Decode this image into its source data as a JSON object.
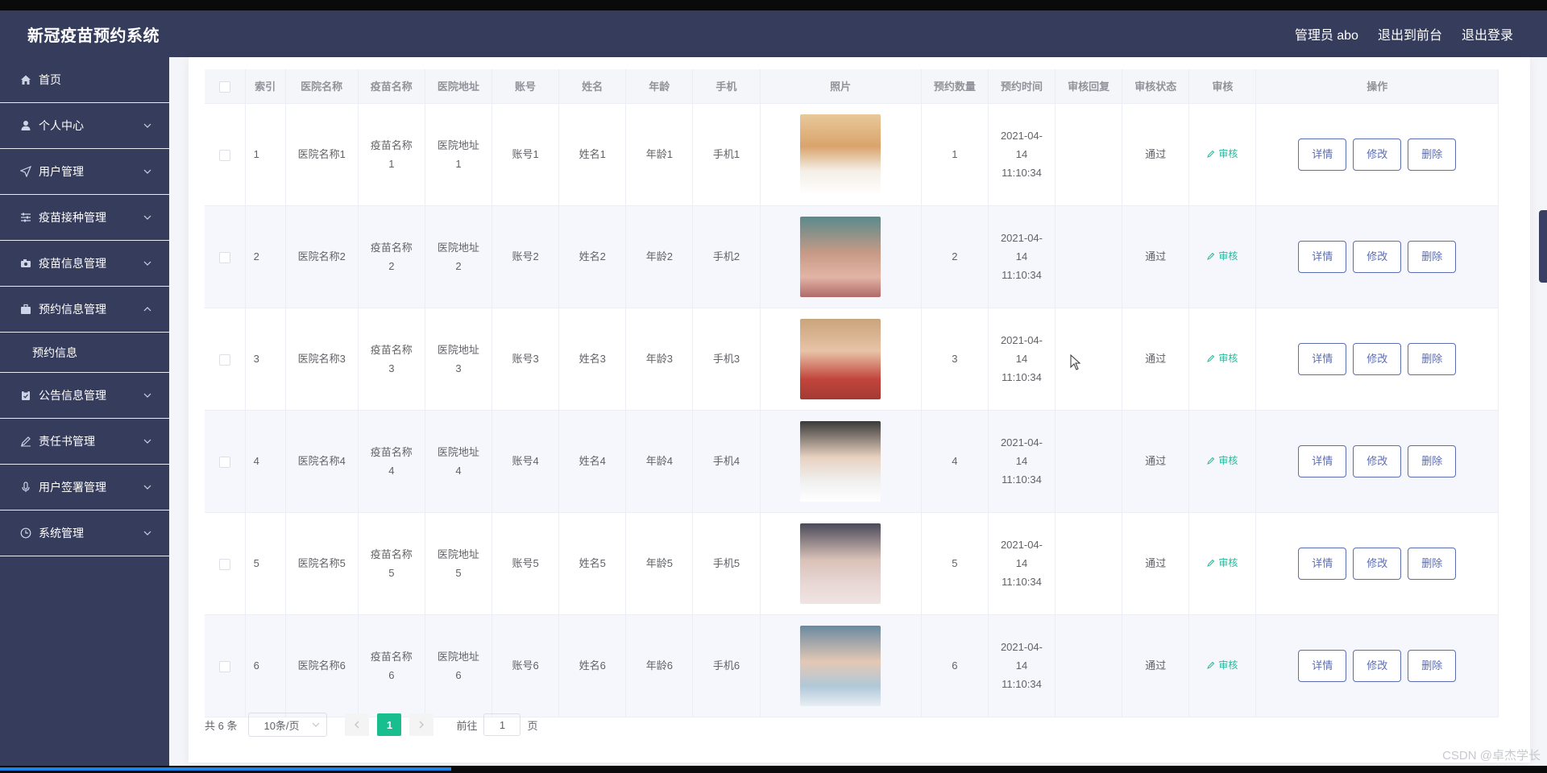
{
  "app": {
    "title": "新冠疫苗预约系统"
  },
  "header": {
    "user": "管理员 abo",
    "front": "退出到前台",
    "logout": "退出登录"
  },
  "sidebar": {
    "items": [
      {
        "label": "首页",
        "icon": "home-icon",
        "expandable": false
      },
      {
        "label": "个人中心",
        "icon": "user-icon",
        "expandable": true
      },
      {
        "label": "用户管理",
        "icon": "send-icon",
        "expandable": true
      },
      {
        "label": "疫苗接种管理",
        "icon": "sliders-icon",
        "expandable": true
      },
      {
        "label": "疫苗信息管理",
        "icon": "camera-icon",
        "expandable": true
      },
      {
        "label": "预约信息管理",
        "icon": "briefcase-icon",
        "expandable": true,
        "expanded": true
      },
      {
        "label": "公告信息管理",
        "icon": "clipboard-icon",
        "expandable": true
      },
      {
        "label": "责任书管理",
        "icon": "pen-icon",
        "expandable": true
      },
      {
        "label": "用户签署管理",
        "icon": "microphone-icon",
        "expandable": true
      },
      {
        "label": "系统管理",
        "icon": "clock-icon",
        "expandable": true
      }
    ],
    "submenu": {
      "label": "预约信息"
    }
  },
  "table": {
    "columns": [
      "",
      "索引",
      "医院名称",
      "疫苗名称",
      "医院地址",
      "账号",
      "姓名",
      "年龄",
      "手机",
      "照片",
      "预约数量",
      "预约时间",
      "审核回复",
      "审核状态",
      "审核",
      "操作"
    ],
    "rows": [
      {
        "index": "1",
        "hospital": "医院名称1",
        "vaccine": "疫苗名称1",
        "address": "医院地址1",
        "account": "账号1",
        "name": "姓名1",
        "age": "年龄1",
        "phone": "手机1",
        "count": "1",
        "time": "2021-04-14 11:10:34",
        "reply": "",
        "status": "通过",
        "photo": "photo-1"
      },
      {
        "index": "2",
        "hospital": "医院名称2",
        "vaccine": "疫苗名称2",
        "address": "医院地址2",
        "account": "账号2",
        "name": "姓名2",
        "age": "年龄2",
        "phone": "手机2",
        "count": "2",
        "time": "2021-04-14 11:10:34",
        "reply": "",
        "status": "通过",
        "photo": "photo-2"
      },
      {
        "index": "3",
        "hospital": "医院名称3",
        "vaccine": "疫苗名称3",
        "address": "医院地址3",
        "account": "账号3",
        "name": "姓名3",
        "age": "年龄3",
        "phone": "手机3",
        "count": "3",
        "time": "2021-04-14 11:10:34",
        "reply": "",
        "status": "通过",
        "photo": "photo-3"
      },
      {
        "index": "4",
        "hospital": "医院名称4",
        "vaccine": "疫苗名称4",
        "address": "医院地址4",
        "account": "账号4",
        "name": "姓名4",
        "age": "年龄4",
        "phone": "手机4",
        "count": "4",
        "time": "2021-04-14 11:10:34",
        "reply": "",
        "status": "通过",
        "photo": "photo-4"
      },
      {
        "index": "5",
        "hospital": "医院名称5",
        "vaccine": "疫苗名称5",
        "address": "医院地址5",
        "account": "账号5",
        "name": "姓名5",
        "age": "年龄5",
        "phone": "手机5",
        "count": "5",
        "time": "2021-04-14 11:10:34",
        "reply": "",
        "status": "通过",
        "photo": "photo-5"
      },
      {
        "index": "6",
        "hospital": "医院名称6",
        "vaccine": "疫苗名称6",
        "address": "医院地址6",
        "account": "账号6",
        "name": "姓名6",
        "age": "年龄6",
        "phone": "手机6",
        "count": "6",
        "time": "2021-04-14 11:10:34",
        "reply": "",
        "status": "通过",
        "photo": "photo-6"
      }
    ],
    "actions": {
      "audit": "审核",
      "detail": "详情",
      "edit": "修改",
      "delete": "删除"
    }
  },
  "pagination": {
    "total": "共 6 条",
    "page_size": "10条/页",
    "current": "1",
    "goto_prefix": "前往",
    "goto_value": "1",
    "goto_suffix": "页"
  },
  "watermark": "CSDN @卓杰学长",
  "colors": {
    "sidebar": "#363c5c",
    "accent_green": "#19be8f",
    "button_border": "#5b6db4"
  }
}
